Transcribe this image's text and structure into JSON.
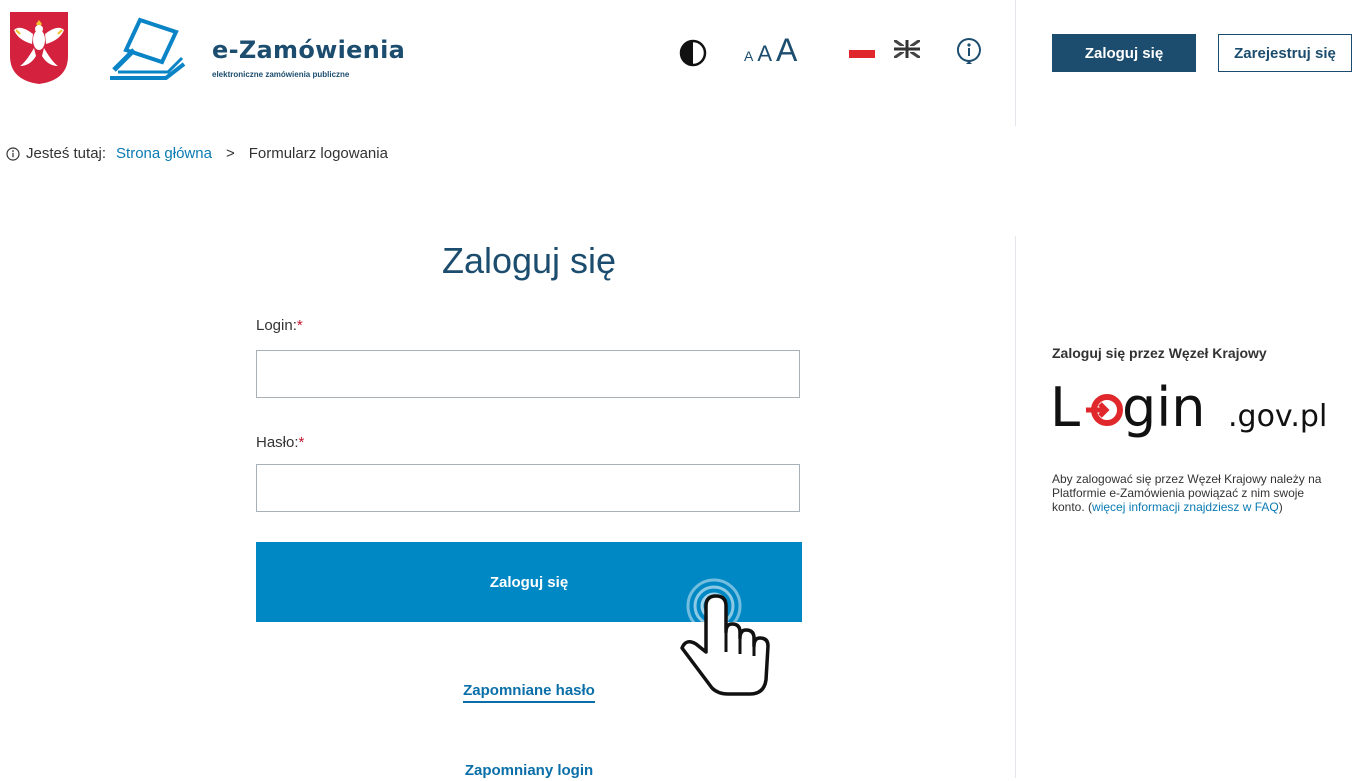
{
  "header": {
    "brand_name": "e-Zamówienia",
    "brand_sub": "elektroniczne zamówienia publiczne",
    "font_size_small": "A",
    "font_size_medium": "A",
    "font_size_large": "A",
    "login_button": "Zaloguj się",
    "register_button": "Zarejestruj się",
    "icons": [
      "polish-emblem-icon",
      "contrast-icon",
      "flag-pl-icon",
      "flag-uk-icon",
      "info-icon"
    ]
  },
  "breadcrumb": {
    "prefix": "Jesteś tutaj:",
    "home": "Strona główna",
    "separator": ">",
    "current": "Formularz logowania"
  },
  "form": {
    "title": "Zaloguj się",
    "login_label": "Login:",
    "password_label": "Hasło:",
    "required_mark": "*",
    "login_value": "",
    "password_value": "",
    "submit": "Zaloguj się",
    "forgot_password": "Zapomniane hasło",
    "forgot_login": "Zapomniany login"
  },
  "sidebar": {
    "title": "Zaloguj się przez Węzeł Krajowy",
    "logo_main": "Login",
    "logo_domain": ".gov.pl",
    "desc_prefix": "Aby zalogować się przez Węzeł Krajowy należy na Platformie e-Zamówienia powiązać z nim swoje konto. (",
    "desc_link": "więcej informacji znajdziesz w FAQ",
    "desc_suffix": ")"
  },
  "colors": {
    "primary": "#1c4d6e",
    "accent": "#0088c4",
    "link": "#0a7bb3",
    "required": "#c0162e",
    "logo_red": "#e0272b"
  }
}
